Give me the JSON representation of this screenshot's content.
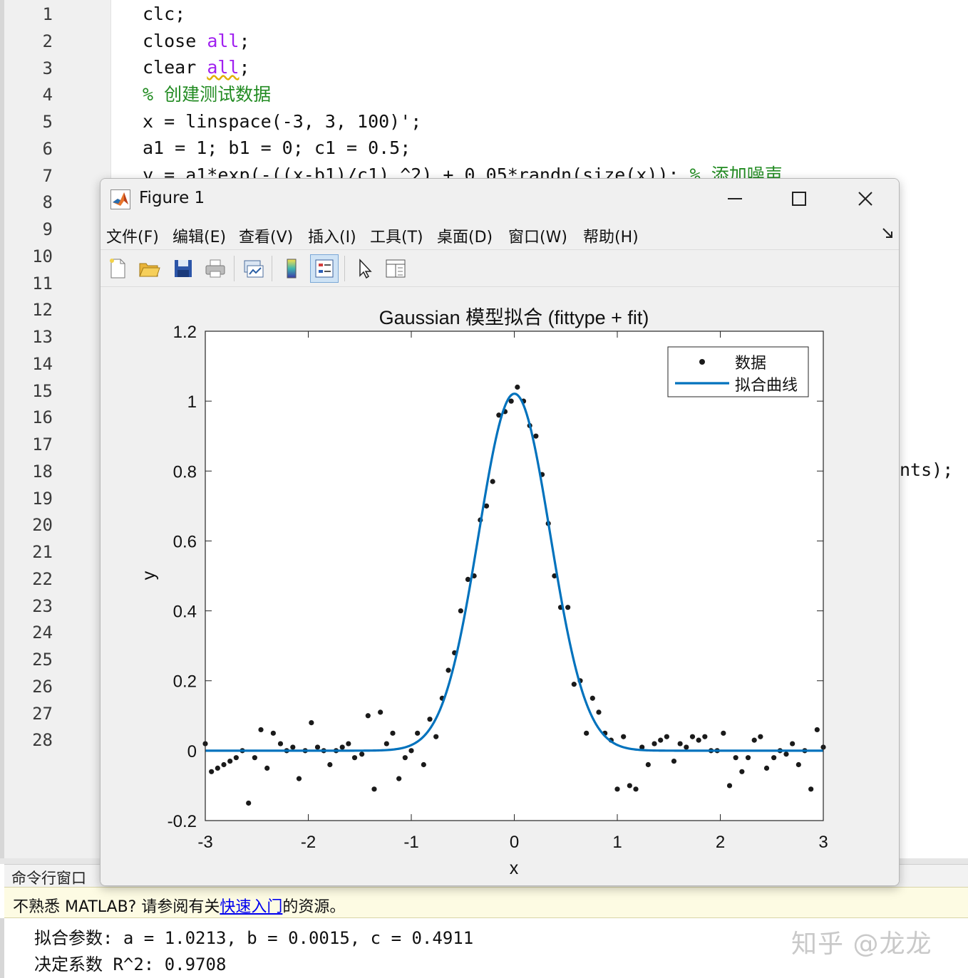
{
  "editor": {
    "line_numbers": [
      "1",
      "2",
      "3",
      "4",
      "5",
      "6",
      "7",
      "8",
      "9",
      "10",
      "11",
      "12",
      "13",
      "14",
      "15",
      "16",
      "17",
      "18",
      "19",
      "20",
      "21",
      "22",
      "23",
      "24",
      "25",
      "26",
      "27",
      "28"
    ],
    "code": {
      "l1": "clc;",
      "l2_a": "close ",
      "l2_kw": "all",
      "l2_b": ";",
      "l3_a": "clear ",
      "l3_kw": "all",
      "l3_b": ";",
      "l4_comment": "% 创建测试数据",
      "l5": "x = linspace(-3, 3, 100)';",
      "l6": "a1 = 1; b1 = 0; c1 = 0.5;",
      "l7_code": "y = a1*exp(-((x-b1)/c1).^2) + 0.05*randn(size(x)); ",
      "l7_comment": "% 添加噪声",
      "l18_tail": "nts);"
    }
  },
  "figure": {
    "title": "Figure 1",
    "menu": [
      "文件(F)",
      "编辑(E)",
      "查看(V)",
      "插入(I)",
      "工具(T)",
      "桌面(D)",
      "窗口(W)",
      "帮助(H)"
    ],
    "toolbar_icons": [
      "new-figure-icon",
      "open-file-icon",
      "save-icon",
      "print-icon",
      "link-plot-icon",
      "colorbar-icon",
      "legend-icon",
      "edit-plot-icon",
      "property-inspector-icon"
    ]
  },
  "command_window": {
    "title": "命令行窗口",
    "notice_prefix": "不熟悉 MATLAB? 请参阅有关",
    "notice_link": "快速入门",
    "notice_suffix": "的资源。",
    "output_1": "拟合参数: a = 1.0213, b = 0.0015, c = 0.4911",
    "output_2": "决定系数 R^2: 0.9708"
  },
  "watermark": "知乎 @龙龙",
  "colors": {
    "fit_line": "#0072bd",
    "data_points": "#1a1a1a",
    "keyword": "#a020f0",
    "comment": "#228b22",
    "link": "#0000ee"
  },
  "chart_data": {
    "type": "scatter",
    "title": "Gaussian 模型拟合 (fittype + fit)",
    "xlabel": "x",
    "ylabel": "y",
    "xlim": [
      -3,
      3
    ],
    "ylim": [
      -0.2,
      1.2
    ],
    "xticks": [
      "-3",
      "-2",
      "-1",
      "0",
      "1",
      "2",
      "3"
    ],
    "yticks": [
      "-0.2",
      "0",
      "0.2",
      "0.4",
      "0.6",
      "0.8",
      "1",
      "1.2"
    ],
    "legend_position": "top-right",
    "series": [
      {
        "name": "数据",
        "style": "points",
        "points": [
          [
            -3.0,
            0.02
          ],
          [
            -2.94,
            -0.06
          ],
          [
            -2.88,
            -0.05
          ],
          [
            -2.82,
            -0.04
          ],
          [
            -2.76,
            -0.03
          ],
          [
            -2.7,
            -0.02
          ],
          [
            -2.64,
            0.0
          ],
          [
            -2.58,
            -0.15
          ],
          [
            -2.52,
            -0.02
          ],
          [
            -2.46,
            0.06
          ],
          [
            -2.4,
            -0.05
          ],
          [
            -2.34,
            0.05
          ],
          [
            -2.27,
            0.02
          ],
          [
            -2.21,
            0.0
          ],
          [
            -2.15,
            0.01
          ],
          [
            -2.09,
            -0.08
          ],
          [
            -2.03,
            0.0
          ],
          [
            -1.97,
            0.08
          ],
          [
            -1.91,
            0.01
          ],
          [
            -1.85,
            0.0
          ],
          [
            -1.79,
            -0.04
          ],
          [
            -1.73,
            0.0
          ],
          [
            -1.67,
            0.01
          ],
          [
            -1.61,
            0.02
          ],
          [
            -1.55,
            -0.02
          ],
          [
            -1.48,
            -0.01
          ],
          [
            -1.42,
            0.1
          ],
          [
            -1.36,
            -0.11
          ],
          [
            -1.3,
            0.11
          ],
          [
            -1.24,
            0.02
          ],
          [
            -1.18,
            0.05
          ],
          [
            -1.12,
            -0.08
          ],
          [
            -1.06,
            -0.02
          ],
          [
            -1.0,
            0.0
          ],
          [
            -0.94,
            0.05
          ],
          [
            -0.88,
            -0.04
          ],
          [
            -0.82,
            0.09
          ],
          [
            -0.76,
            0.04
          ],
          [
            -0.7,
            0.15
          ],
          [
            -0.64,
            0.23
          ],
          [
            -0.58,
            0.28
          ],
          [
            -0.52,
            0.4
          ],
          [
            -0.45,
            0.49
          ],
          [
            -0.39,
            0.5
          ],
          [
            -0.33,
            0.66
          ],
          [
            -0.27,
            0.7
          ],
          [
            -0.21,
            0.77
          ],
          [
            -0.15,
            0.96
          ],
          [
            -0.09,
            0.97
          ],
          [
            -0.03,
            1.0
          ],
          [
            0.03,
            1.04
          ],
          [
            0.09,
            1.0
          ],
          [
            0.15,
            0.93
          ],
          [
            0.21,
            0.9
          ],
          [
            0.27,
            0.79
          ],
          [
            0.33,
            0.65
          ],
          [
            0.39,
            0.5
          ],
          [
            0.45,
            0.41
          ],
          [
            0.52,
            0.41
          ],
          [
            0.58,
            0.19
          ],
          [
            0.64,
            0.2
          ],
          [
            0.7,
            0.05
          ],
          [
            0.76,
            0.15
          ],
          [
            0.82,
            0.11
          ],
          [
            0.88,
            0.05
          ],
          [
            0.94,
            0.03
          ],
          [
            1.0,
            -0.11
          ],
          [
            1.06,
            0.04
          ],
          [
            1.12,
            -0.1
          ],
          [
            1.18,
            -0.11
          ],
          [
            1.24,
            0.01
          ],
          [
            1.3,
            -0.04
          ],
          [
            1.36,
            0.02
          ],
          [
            1.42,
            0.03
          ],
          [
            1.48,
            0.04
          ],
          [
            1.55,
            -0.03
          ],
          [
            1.61,
            0.02
          ],
          [
            1.67,
            0.01
          ],
          [
            1.73,
            0.04
          ],
          [
            1.79,
            0.03
          ],
          [
            1.85,
            0.04
          ],
          [
            1.91,
            0.0
          ],
          [
            1.97,
            0.0
          ],
          [
            2.03,
            0.05
          ],
          [
            2.09,
            -0.1
          ],
          [
            2.15,
            -0.02
          ],
          [
            2.21,
            -0.06
          ],
          [
            2.27,
            -0.02
          ],
          [
            2.33,
            0.03
          ],
          [
            2.39,
            0.04
          ],
          [
            2.45,
            -0.05
          ],
          [
            2.52,
            -0.02
          ],
          [
            2.58,
            0.0
          ],
          [
            2.64,
            -0.01
          ],
          [
            2.7,
            0.02
          ],
          [
            2.76,
            -0.04
          ],
          [
            2.82,
            0.0
          ],
          [
            2.88,
            -0.11
          ],
          [
            2.94,
            0.06
          ],
          [
            3.0,
            0.01
          ]
        ]
      },
      {
        "name": "拟合曲线",
        "style": "line",
        "model": "a*exp(-((x-b)/c)^2)",
        "params": {
          "a": 1.0213,
          "b": 0.0015,
          "c": 0.4911
        }
      }
    ]
  }
}
